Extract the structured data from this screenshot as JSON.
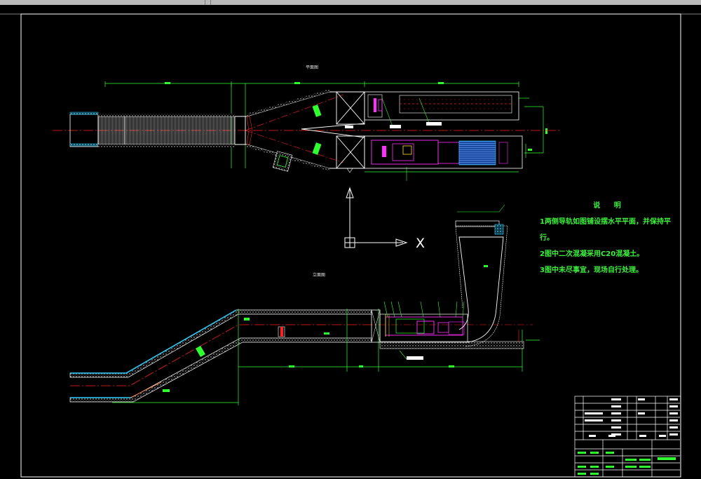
{
  "view_labels": {
    "plan": "平面图",
    "elevation": "立面图"
  },
  "ucs": {
    "x_label": "X"
  },
  "notes": {
    "title": "说 明",
    "items": [
      "1两侧导轨如图铺设摆水平平面，并保持平行。",
      "2图中二次混凝采用C20混凝土。",
      "3图中未尽事宜，现场自行处理。"
    ]
  },
  "colors": {
    "background": "#000000",
    "outline": "#ffffff",
    "centerline": "#ff2020",
    "dimension": "#30ff30",
    "machinery": "#ff30ff",
    "water": "#30d0ff",
    "notes_text": "#3cf03c"
  }
}
